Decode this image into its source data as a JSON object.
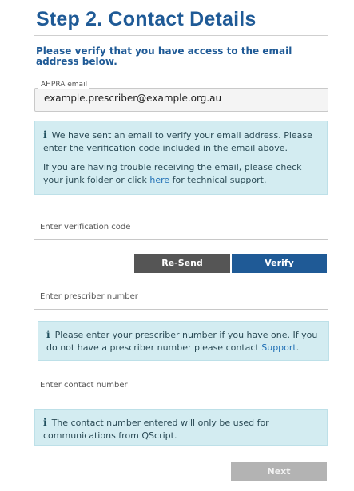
{
  "page": {
    "title": "Step 2. Contact Details",
    "subtitle": "Please verify that you have access to the email address below."
  },
  "email_field": {
    "legend": "AHPRA email",
    "value": "example.prescriber@example.org.au"
  },
  "email_info": {
    "line1": "We have sent an email to verify your email address. Please enter the verification code included in the email above.",
    "line2_pre": "If you are having trouble receiving the email, please check your junk folder or click ",
    "line2_link": "here",
    "line2_post": " for technical support."
  },
  "verification": {
    "placeholder": "Enter verification code",
    "resend_label": "Re-Send",
    "verify_label": "Verify"
  },
  "prescriber": {
    "placeholder": "Enter prescriber number",
    "info_pre": "Please enter your prescriber number if you have one. If you do not  have a prescriber number please contact ",
    "info_link": "Support",
    "info_post": "."
  },
  "contact": {
    "placeholder": "Enter contact number",
    "info": "The contact number entered will only be used for communications from QScript."
  },
  "footer": {
    "next_label": "Next"
  },
  "colors": {
    "brand_blue": "#1f5a96",
    "info_bg": "#d3ecf1",
    "resend_bg": "#555555",
    "verify_bg": "#1f5a96",
    "disabled_bg": "#b3b3b3"
  }
}
